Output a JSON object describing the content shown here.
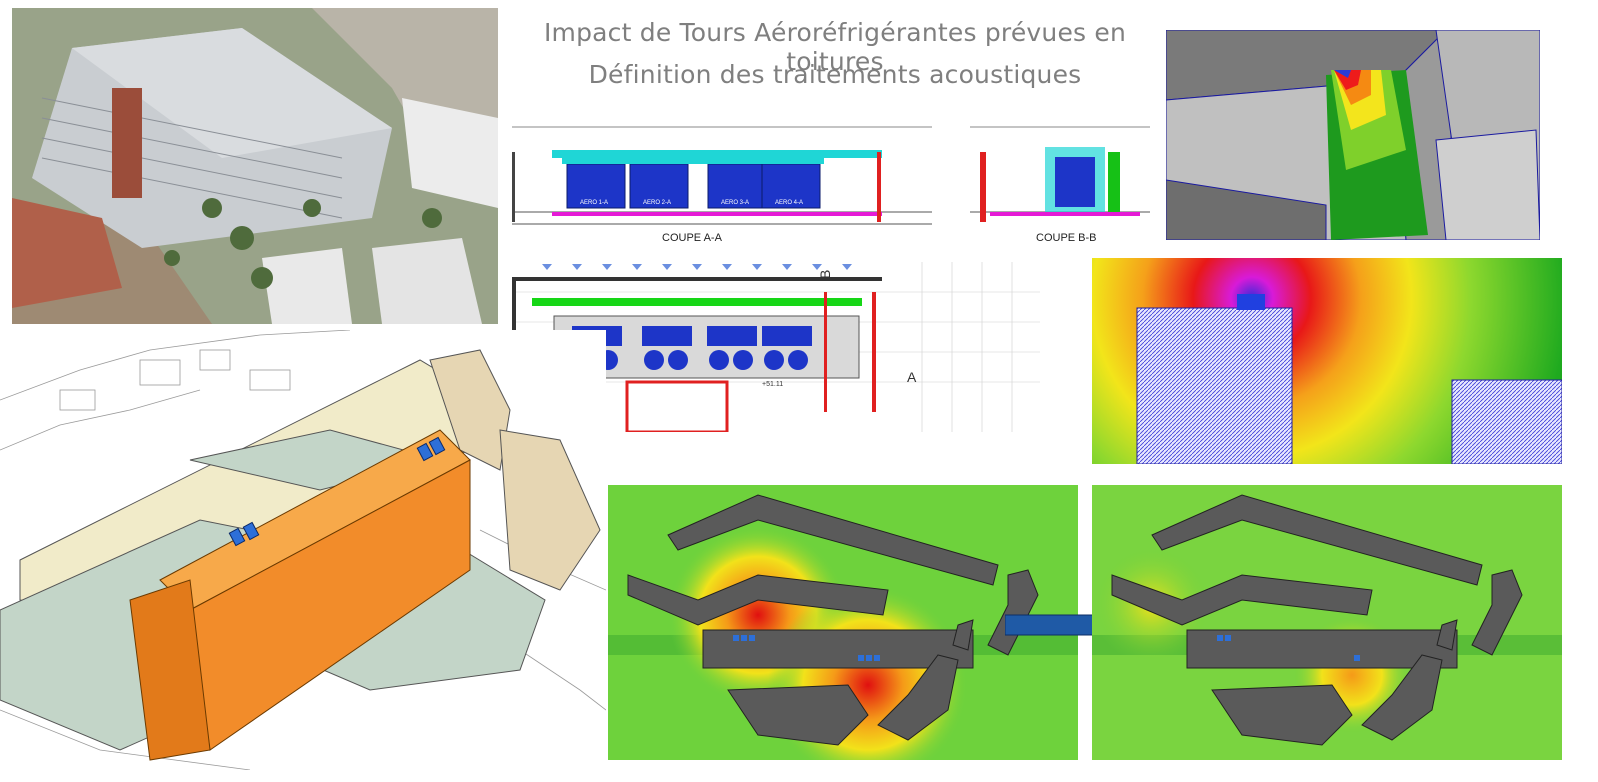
{
  "title": {
    "line1": "Impact de Tours Aéroréfrigérantes prévues en toitures",
    "line2": "Définition des traitements acoustiques"
  },
  "sections": {
    "coupe_aa": "COUPE A-A",
    "coupe_bb": "COUPE B-B",
    "marker_b": "B",
    "marker_a": "A"
  },
  "units": [
    "AERO 1-A",
    "AERO 2-A",
    "AERO 3-A",
    "AERO 4-A"
  ],
  "plan_label": "+51.11",
  "colors": {
    "accent_blue": "#1f5aa6",
    "orange_building": "#f28c2a",
    "noise_green": "#6ed23c",
    "noise_red": "#e01010"
  }
}
